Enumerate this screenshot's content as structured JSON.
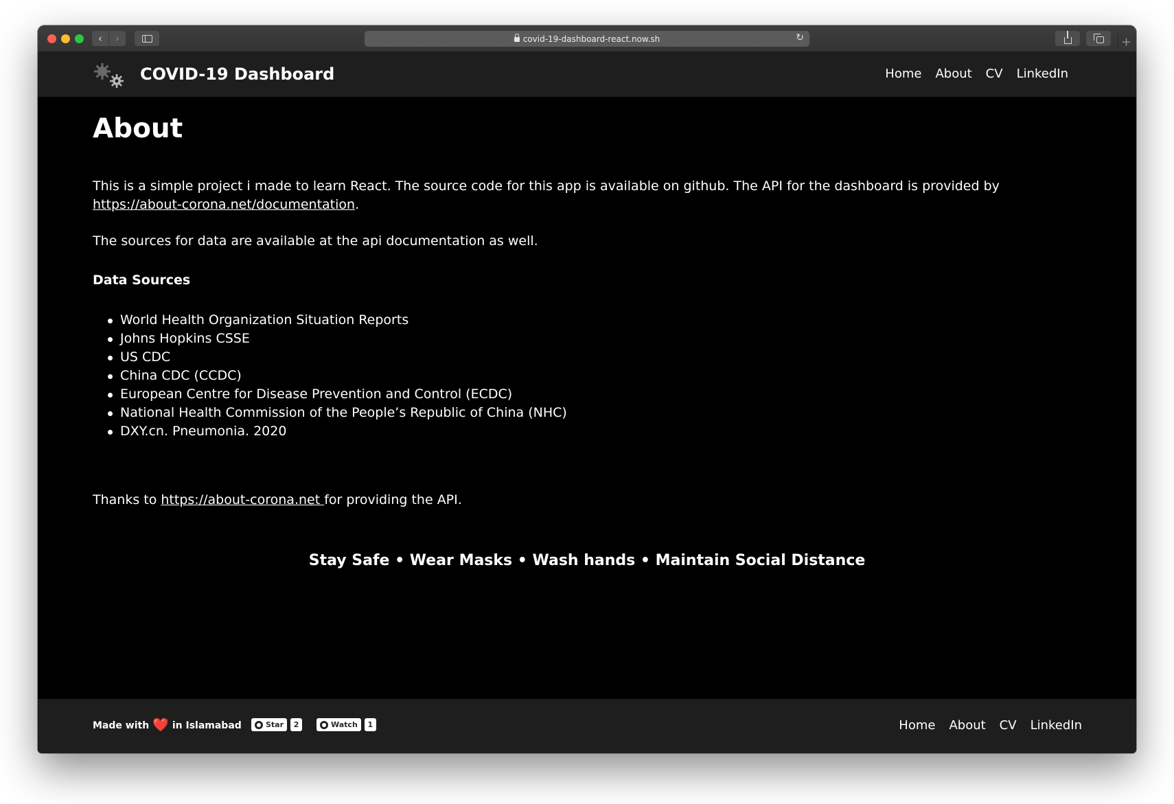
{
  "browser": {
    "url": "covid-19-dashboard-react.now.sh"
  },
  "navbar": {
    "brand": "COVID-19 Dashboard",
    "links": [
      "Home",
      "About",
      "CV",
      "LinkedIn"
    ]
  },
  "about": {
    "heading": "About",
    "intro_text": "This is a simple project i made to learn React. The source code for this app is available on github. The API for the dashboard is provided by ",
    "intro_link": "https://about-corona.net/documentation",
    "intro_end": ".",
    "sources_note": "The sources for data are available at the api documentation as well.",
    "sources_heading": "Data Sources",
    "sources": [
      "World Health Organization Situation Reports",
      "Johns Hopkins CSSE",
      "US CDC",
      "China CDC (CCDC)",
      "European Centre for Disease Prevention and Control (ECDC)",
      "National Health Commission of the People’s Republic of China (NHC)",
      "DXY.cn. Pneumonia. 2020"
    ],
    "thanks_prefix": "Thanks to ",
    "thanks_link": "https://about-corona.net ",
    "thanks_suffix": "for providing the API.",
    "tagline": "Stay Safe • Wear Masks • Wash hands • Maintain Social Distance"
  },
  "footer": {
    "made_with": "Made with",
    "heart": "❤️",
    "location": "in Islamabad",
    "github_star_label": "Star",
    "github_star_count": "2",
    "github_watch_label": "Watch",
    "github_watch_count": "1",
    "links": [
      "Home",
      "About",
      "CV",
      "LinkedIn"
    ]
  }
}
